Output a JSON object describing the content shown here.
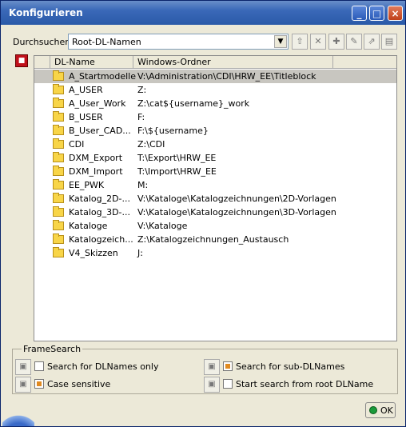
{
  "window": {
    "title": "Konfigurieren"
  },
  "search": {
    "label": "Durchsuchen:",
    "value": "Root-DL-Namen"
  },
  "table": {
    "headers": [
      "DL-Name",
      "Windows-Ordner"
    ],
    "rows": [
      {
        "dl": "A_Startmodelle",
        "win": "V:\\Administration\\CDI\\HRW_EE\\Titleblock"
      },
      {
        "dl": "A_USER",
        "win": "Z:"
      },
      {
        "dl": "A_User_Work",
        "win": "Z:\\cat${username}_work"
      },
      {
        "dl": "B_USER",
        "win": "F:"
      },
      {
        "dl": "B_User_CAD...",
        "win": "F:\\${username}"
      },
      {
        "dl": "CDI",
        "win": "Z:\\CDI"
      },
      {
        "dl": "DXM_Export",
        "win": "T:\\Export\\HRW_EE"
      },
      {
        "dl": "DXM_Import",
        "win": "T:\\Import\\HRW_EE"
      },
      {
        "dl": "EE_PWK",
        "win": "M:"
      },
      {
        "dl": "Katalog_2D-...",
        "win": "V:\\Kataloge\\Katalogzeichnungen\\2D-Vorlagen"
      },
      {
        "dl": "Katalog_3D-...",
        "win": "V:\\Kataloge\\Katalogzeichnungen\\3D-Vorlagen"
      },
      {
        "dl": "Kataloge",
        "win": "V:\\Kataloge"
      },
      {
        "dl": "Katalogzeich...",
        "win": "Z:\\Katalogzeichnungen_Austausch"
      },
      {
        "dl": "V4_Skizzen",
        "win": "J:"
      }
    ]
  },
  "framesearch": {
    "title": "FrameSearch",
    "options": [
      {
        "label": "Search for DLNames only",
        "checked": false
      },
      {
        "label": "Case sensitive",
        "checked": true
      },
      {
        "label": "Search for sub-DLNames",
        "checked": true
      },
      {
        "label": "Start search from root DLName",
        "checked": false
      }
    ]
  },
  "ok_label": "OK"
}
